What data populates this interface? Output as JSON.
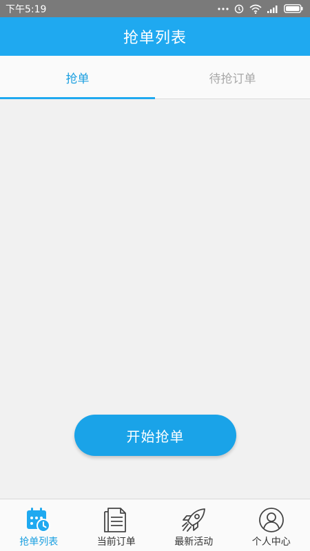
{
  "status_bar": {
    "time": "下午5:19"
  },
  "header": {
    "title": "抢单列表"
  },
  "tabs": [
    {
      "label": "抢单",
      "active": true
    },
    {
      "label": "待抢订单",
      "active": false
    }
  ],
  "main": {
    "start_button_label": "开始抢单"
  },
  "bottom_nav": [
    {
      "label": "抢单列表",
      "icon": "calendar-clock-icon",
      "active": true
    },
    {
      "label": "当前订单",
      "icon": "document-icon",
      "active": false
    },
    {
      "label": "最新活动",
      "icon": "rocket-icon",
      "active": false
    },
    {
      "label": "个人中心",
      "icon": "user-icon",
      "active": false
    }
  ],
  "colors": {
    "primary": "#1fa9f0",
    "active_text": "#1a9fe0",
    "status_bar": "#7a7a7a",
    "background": "#f1f1f1"
  }
}
